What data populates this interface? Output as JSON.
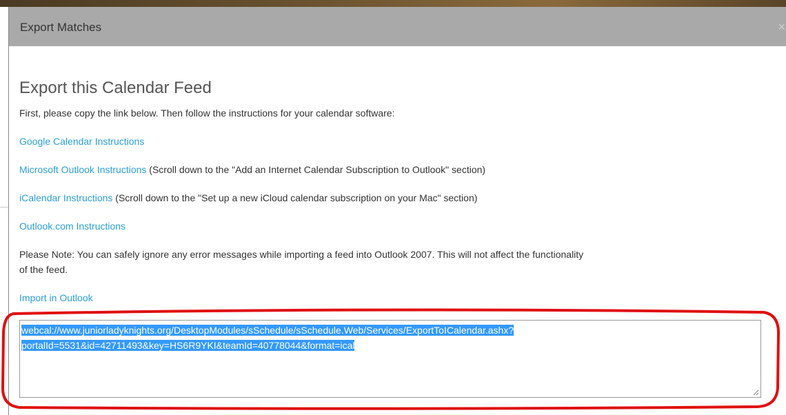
{
  "dialog": {
    "title": "Export Matches",
    "close_glyph": "×"
  },
  "content": {
    "heading": "Export this Calendar Feed",
    "intro": "First, please copy the link below. Then follow the instructions for your calendar software:",
    "google_link": "Google Calendar Instructions",
    "outlook_link": "Microsoft Outlook Instructions",
    "outlook_note": " (Scroll down to the \"Add an Internet Calendar Subscription to Outlook\" section)",
    "icalendar_link": "iCalendar Instructions",
    "icalendar_note": " (Scroll down to the \"Set up a new iCloud calendar subscription on your Mac\" section)",
    "outlookcom_link": "Outlook.com Instructions",
    "note_line1": "Please Note: You can safely ignore any error messages while importing a feed into Outlook 2007. This will not affect the functionality",
    "note_line2": "of the feed.",
    "import_link": "Import in Outlook"
  },
  "feed": {
    "url": "webcal://www.juniorladyknights.org/DesktopModules/sSchedule/sSchedule.Web/Services/ExportToICalendar.ashx?portalId=5531&id=42711493&key=HS6R9YKI&teamId=40778044&format=ical",
    "url_line1": "webcal://www.juniorladyknights.org/DesktopModules/sSchedule/sSchedule.Web/Services/ExportToICalendar.ashx?",
    "url_line2": "portalId=5531&id=42711493&key=HS6R9YKI&teamId=40778044&format=ical"
  },
  "colors": {
    "link": "#2a9fd6",
    "header_bg": "#a9a9a9",
    "selection": "#3399ff",
    "annotation": "#e01010"
  }
}
